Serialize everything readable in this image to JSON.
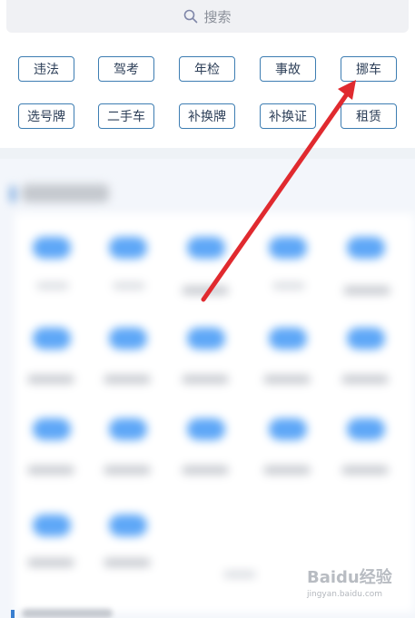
{
  "search": {
    "placeholder": "搜索"
  },
  "tags": [
    {
      "label": "违法"
    },
    {
      "label": "驾考"
    },
    {
      "label": "年检"
    },
    {
      "label": "事故"
    },
    {
      "label": "挪车"
    },
    {
      "label": "选号牌"
    },
    {
      "label": "二手车"
    },
    {
      "label": "补换牌"
    },
    {
      "label": "补换证"
    },
    {
      "label": "租赁"
    }
  ],
  "watermark": {
    "brand": "Baidu经验",
    "url": "jingyan.baidu.com"
  },
  "colors": {
    "accent": "#3d7db2",
    "arrow": "#e02a2f",
    "blurred_icon": "#5ea7f7"
  }
}
